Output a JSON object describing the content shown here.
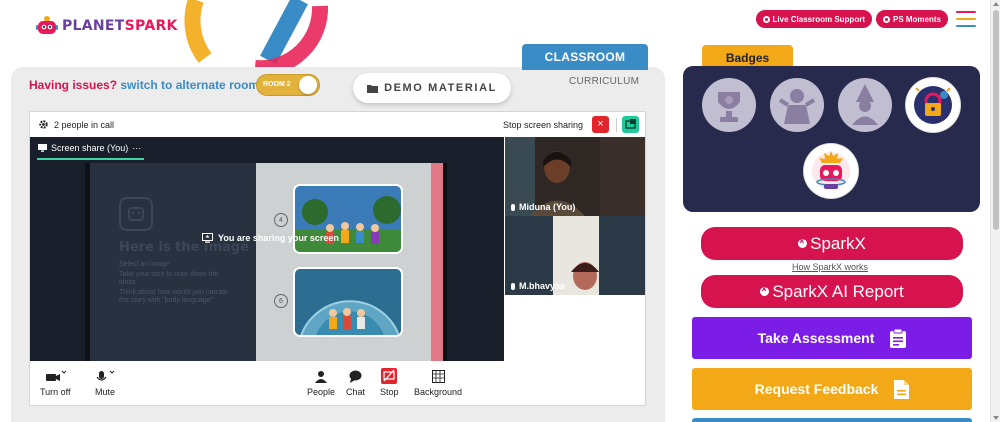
{
  "brand": {
    "planet": "PLANET",
    "spark": "SPARK",
    "colors": {
      "planet": "#6b3fa0",
      "spark": "#e8185a"
    }
  },
  "top_right": {
    "live_support": "Live Classroom Support",
    "ps_moments": "PS Moments",
    "menu_icon": "hamburger-icon",
    "menu_colors": [
      "#e8185a",
      "#f3a817",
      "#3a8cc7"
    ]
  },
  "classroom": {
    "tab_label": "CLASSROOM",
    "curriculum_label": "CURRICULUM",
    "issues_prefix": "Having issues?",
    "issues_link": "switch to alternate room",
    "room_toggle": "ROOM 2",
    "demo_material": "DEMO MATERIAL"
  },
  "meeting": {
    "people_count": "2 people in call",
    "stop_screen_sharing": "Stop screen sharing",
    "screen_share_tab": "Screen share (You)",
    "sharing_message": "You are sharing your screen",
    "slide": {
      "title": "Here is the image",
      "bullets": [
        "Select an image",
        "Take your time to note down the ideas",
        "Think about how would you narrate the story with \"body language\""
      ],
      "card_numbers": [
        "4",
        "6"
      ]
    },
    "participants": [
      {
        "name": "Miduna (You)"
      },
      {
        "name": "M.bhavyaa"
      }
    ],
    "controls": {
      "turn_off": "Turn off",
      "mute": "Mute",
      "people": "People",
      "chat": "Chat",
      "stop": "Stop",
      "background": "Background"
    }
  },
  "badges": {
    "title": "Badges",
    "items": [
      "trophy-badge-icon",
      "superhero-badge-icon",
      "wizard-badge-icon",
      "lock-badge-icon",
      "robot-badge-icon"
    ]
  },
  "actions": {
    "sparkx": "SparkX",
    "how_sparkx": "How SparkX works",
    "sparkx_ai_report": "SparkX AI Report",
    "take_assessment": "Take Assessment",
    "request_feedback": "Request Feedback",
    "colors": {
      "pink": "#d6134f",
      "purple": "#7b1de6",
      "orange": "#f3a817",
      "blue": "#3a8cc7"
    }
  }
}
